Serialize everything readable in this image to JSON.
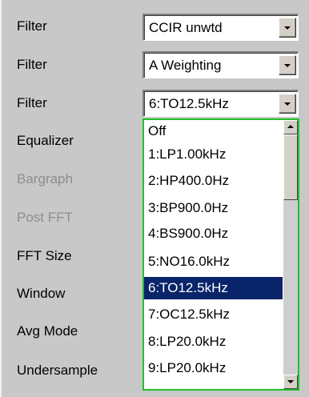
{
  "labels": {
    "filter1": "Filter",
    "filter2": "Filter",
    "filter3": "Filter",
    "equalizer": "Equalizer",
    "bargraph": "Bargraph",
    "post_fft": "Post FFT",
    "fft_size": "FFT Size",
    "window": "Window",
    "avg_mode": "Avg Mode",
    "undersample": "Undersample"
  },
  "combos": {
    "filter1_value": "CCIR unwtd",
    "filter2_value": "A Weighting",
    "filter3_value": "6:TO12.5kHz"
  },
  "dropdown": {
    "options": [
      "Off",
      "1:LP1.00kHz",
      "2:HP400.0Hz",
      "3:BP900.0Hz",
      "4:BS900.0Hz",
      "5:NO16.0kHz",
      "6:TO12.5kHz",
      "7:OC12.5kHz",
      "8:LP20.0kHz",
      "9:LP20.0kHz"
    ],
    "selected_index": 6
  },
  "colors": {
    "panel_bg": "#c8c8c8",
    "selection_bg": "#0a246a",
    "dropdown_border": "#22c02a",
    "disabled_text": "#8d8d8d"
  }
}
